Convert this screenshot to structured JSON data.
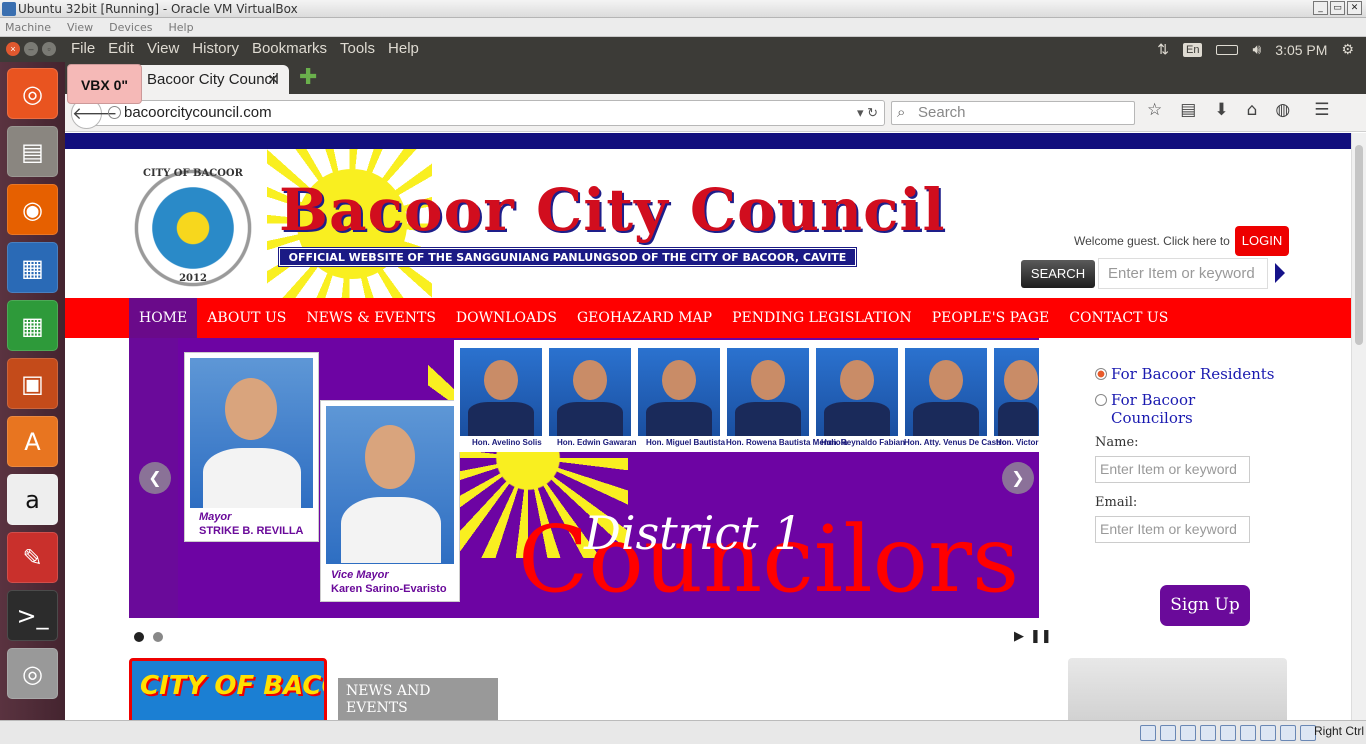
{
  "vbox": {
    "title": "Ubuntu 32bit [Running] - Oracle VM VirtualBox",
    "menu": [
      "Machine",
      "View",
      "Devices",
      "Help"
    ],
    "host_key": "Right Ctrl"
  },
  "ubuntu": {
    "app_menu": [
      "File",
      "Edit",
      "View",
      "History",
      "Bookmarks",
      "Tools",
      "Help"
    ],
    "keyboard": "En",
    "clock": "3:05 PM",
    "launcher": [
      "ubuntu-icon",
      "files-icon",
      "firefox-icon",
      "writer-icon",
      "calc-icon",
      "impress-icon",
      "software-center-icon",
      "amazon-icon",
      "settings-icon",
      "terminal-icon",
      "dvd-icon"
    ]
  },
  "browser": {
    "tab_title": "Bacoor City Council",
    "vbx_badge": "VBX 0\"",
    "url": "bacoorcitycouncil.com",
    "search_placeholder": "Search"
  },
  "site": {
    "seal_top": "CITY OF BACOOR",
    "seal_year": "2012",
    "brand": "Bacoor City Council",
    "tagline": "OFFICIAL WEBSITE OF THE SANGGUNIANG PANLUNGSOD OF THE CITY OF BACOOR, CAVITE",
    "welcome": "Welcome guest. Click here to",
    "login": "LOGIN",
    "search_button": "SEARCH",
    "search_placeholder": "Enter Item or keyword",
    "nav": [
      "HOME",
      "ABOUT US",
      "NEWS & EVENTS",
      "DOWNLOADS",
      "GEOHAZARD MAP",
      "PENDING LEGISLATION",
      "PEOPLE'S PAGE",
      "CONTACT US"
    ],
    "slide": {
      "mayor_role": "Mayor",
      "mayor_name": "STRIKE B. REVILLA",
      "vice_role": "Vice Mayor",
      "vice_name": "Karen Sarino-Evaristo",
      "councilors": [
        "Hon. Avelino Solis",
        "Hon. Edwin Gawaran",
        "Hon. Miguel Bautista",
        "Hon. Rowena Bautista Mendiola",
        "Hon. Reynaldo Fabian",
        "Hon. Atty. Venus De Castro",
        "Hon. Victorio"
      ],
      "headline_1": "District 1",
      "headline_2": "Councilors"
    },
    "sidebar": {
      "radio_1": "For Bacoor Residents",
      "radio_2": "For Bacoor Councilors",
      "name_label": "Name:",
      "email_label": "Email:",
      "input_placeholder": "Enter Item or keyword",
      "signup": "Sign Up"
    },
    "promo_text": "CITY OF BACOOR",
    "news_title": "NEWS AND EVENTS"
  },
  "colors": {
    "nav_red": "#ff0000",
    "slider_purple": "#6a0a9a",
    "stripe_navy": "#120f7d"
  }
}
